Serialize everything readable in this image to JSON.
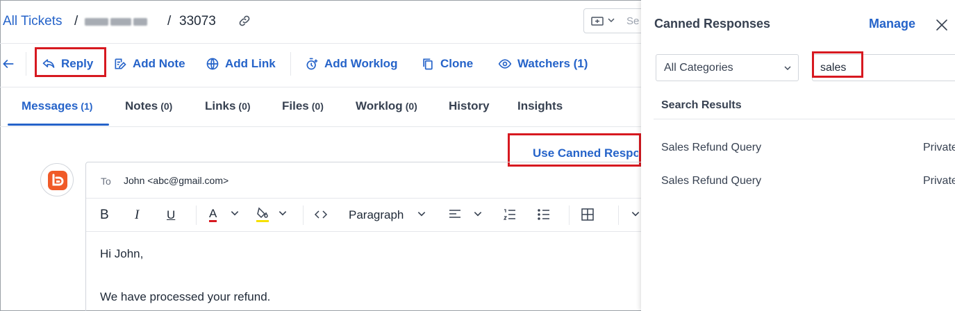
{
  "breadcrumb": {
    "all_tickets": "All Tickets",
    "separator": "/",
    "ticket_id": "33073"
  },
  "search": {
    "placeholder": "Se"
  },
  "actions": {
    "reply": "Reply",
    "add_note": "Add Note",
    "add_link": "Add Link",
    "add_worklog": "Add Worklog",
    "clone": "Clone",
    "watchers": "Watchers (1)"
  },
  "tabs": [
    {
      "label": "Messages",
      "count": "(1)"
    },
    {
      "label": "Notes",
      "count": "(0)"
    },
    {
      "label": "Links",
      "count": "(0)"
    },
    {
      "label": "Files",
      "count": "(0)"
    },
    {
      "label": "Worklog",
      "count": "(0)"
    },
    {
      "label": "History",
      "count": ""
    },
    {
      "label": "Insights",
      "count": ""
    }
  ],
  "use_canned": "Use Canned Response",
  "composer": {
    "to_label": "To",
    "to_value": "John <abc@gmail.com>",
    "format_bold": "B",
    "format_italic": "I",
    "format_underline": "U",
    "format_font_color": "A",
    "format_paragraph": "Paragraph",
    "body_line1": "Hi John,",
    "body_line2": "We have processed your refund."
  },
  "panel": {
    "title": "Canned Responses",
    "manage": "Manage",
    "category": "All Categories",
    "search_value": "sales",
    "results_heading": "Search Results",
    "results": [
      {
        "name": "Sales Refund Query",
        "visibility": "Private"
      },
      {
        "name": "Sales Refund Query",
        "visibility": "Private"
      }
    ]
  },
  "colors": {
    "accent": "#2563c9",
    "highlight": "#d71920",
    "avatar_brand": "#f05a28"
  }
}
